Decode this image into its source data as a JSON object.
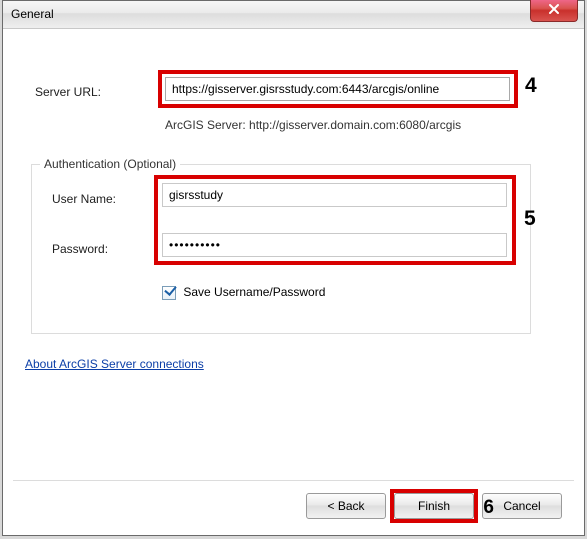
{
  "window": {
    "title": "General"
  },
  "server": {
    "label": "Server URL:",
    "value": "https://gisserver.gisrsstudy.com:6443/arcgis/online",
    "hint": "ArcGIS Server: http://gisserver.domain.com:6080/arcgis"
  },
  "auth": {
    "legend": "Authentication (Optional)",
    "username_label": "User Name:",
    "username_value": "gisrsstudy",
    "password_label": "Password:",
    "password_value": "••••••••••",
    "save_label": " Save Username/Password",
    "save_checked": true
  },
  "link": {
    "text": "About ArcGIS Server connections"
  },
  "buttons": {
    "back": "< Back",
    "finish": "Finish",
    "cancel": "Cancel"
  },
  "annotations": {
    "a4": "4",
    "a5": "5",
    "a6": "6"
  }
}
